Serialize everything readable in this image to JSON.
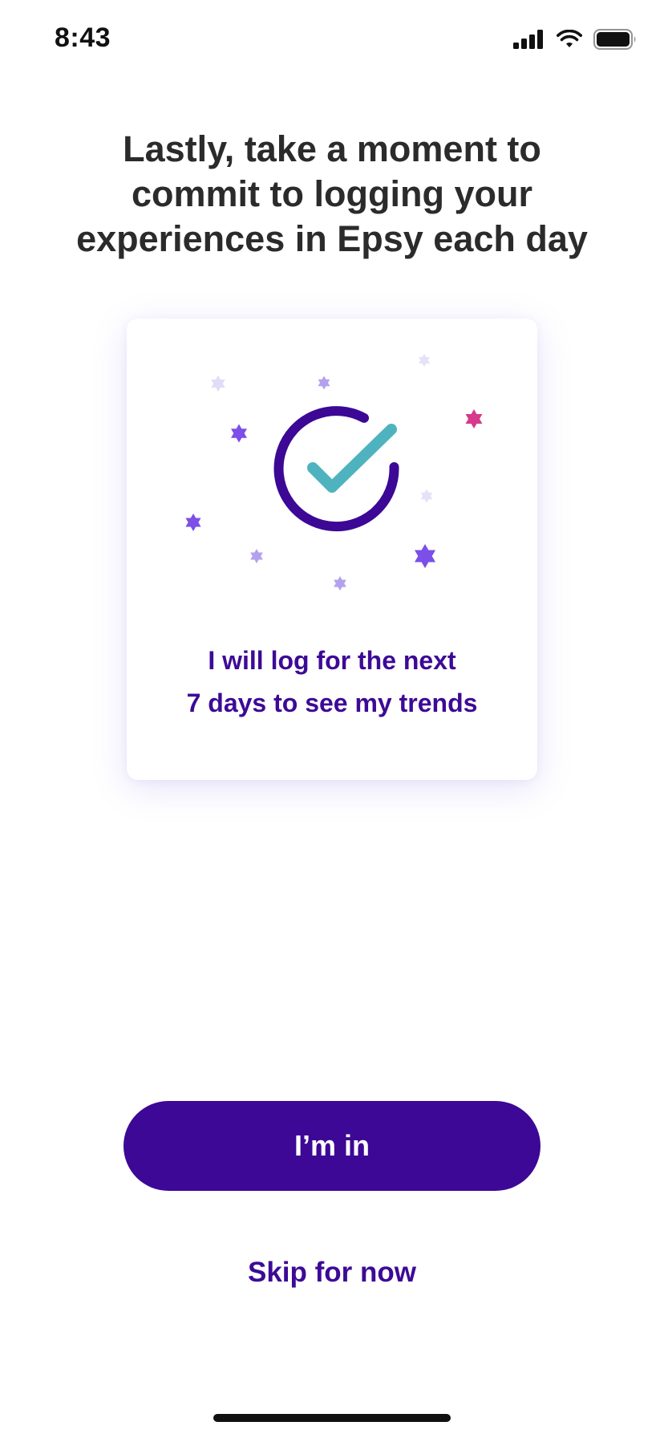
{
  "status_bar": {
    "time": "8:43",
    "icons": [
      "signal-icon",
      "wifi-icon",
      "battery-icon"
    ]
  },
  "headline": {
    "lines": [
      "Lastly, take a moment to",
      "commit to logging your",
      "experiences in Epsy each day"
    ]
  },
  "card": {
    "illustration": "check-circle-icon",
    "text_lines": [
      "I will log for the next",
      "7 days to see my trends"
    ]
  },
  "actions": {
    "primary_label": "I’m in",
    "skip_label": "Skip for now"
  },
  "colors": {
    "brand_purple": "#3c0895",
    "check_teal": "#4fb3bf",
    "star_violet": "#7b4fe8",
    "star_pink": "#d63a8a",
    "headline_text": "#2b2b2b"
  }
}
